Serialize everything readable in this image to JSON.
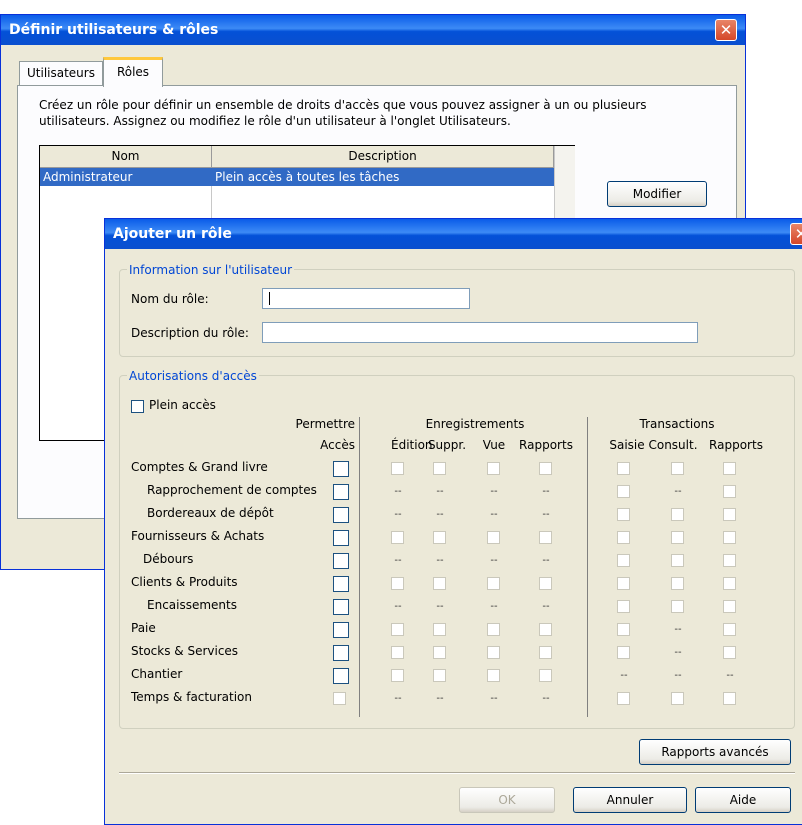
{
  "back_window": {
    "title": "Définir utilisateurs & rôles",
    "tabs": [
      {
        "label": "Utilisateurs"
      },
      {
        "label": "Rôles"
      }
    ],
    "description": "Créez un rôle pour définir un ensemble de droits d'accès que vous pouvez assigner à un ou plusieurs utilisateurs. Assignez ou modifiez le rôle d'un utilisateur à l'onglet Utilisateurs.",
    "table": {
      "columns": [
        "Nom",
        "Description"
      ],
      "rows": [
        {
          "name": "Administrateur",
          "description": "Plein accès à toutes les tâches"
        }
      ]
    },
    "modify_label": "Modifier",
    "close_glyph": "✕"
  },
  "dialog": {
    "title": "Ajouter un rôle",
    "close_glyph": "✕",
    "info_group": {
      "legend": "Information sur l'utilisateur",
      "role_name_label": "Nom du rôle:",
      "role_name_value": "",
      "role_desc_label": "Description du rôle:",
      "role_desc_value": ""
    },
    "access_group": {
      "legend": "Autorisations d'accès",
      "full_access_label": "Plein accès",
      "header_permettre": "Permettre",
      "header_acces": "Accès",
      "header_enregistrements": "Enregistrements",
      "header_transactions": "Transactions",
      "sub_headers": [
        "Édition",
        "Suppr.",
        "Vue",
        "Rapports",
        "Saisie",
        "Consult.",
        "Rapports"
      ],
      "dash": "--",
      "rows": [
        {
          "label": "Comptes & Grand livre"
        },
        {
          "label": "Rapprochement de comptes"
        },
        {
          "label": "Bordereaux de dépôt"
        },
        {
          "label": "Fournisseurs & Achats"
        },
        {
          "label": "Débours"
        },
        {
          "label": "Clients & Produits"
        },
        {
          "label": "Encaissements"
        },
        {
          "label": "Paie"
        },
        {
          "label": "Stocks & Services"
        },
        {
          "label": "Chantier"
        },
        {
          "label": "Temps & facturation"
        }
      ]
    },
    "advanced_reports_label": "Rapports avancés",
    "ok_label": "OK",
    "cancel_label": "Annuler",
    "help_label": "Aide"
  }
}
